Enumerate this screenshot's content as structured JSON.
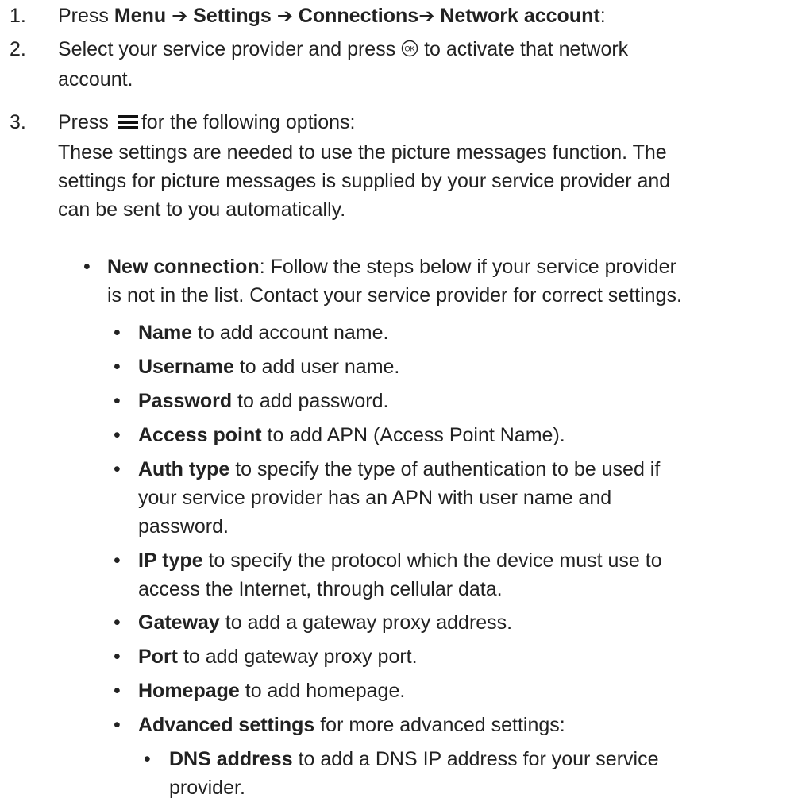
{
  "steps": [
    {
      "num": "1.",
      "press": "Press ",
      "menu": "Menu",
      "arrow": "➔",
      "settings": "Settings",
      "connections": "Connections",
      "network_account": "Network account",
      "tail": ":"
    },
    {
      "num": "2.",
      "line1_pre": "Select your service provider and press ",
      "line1_post": " to activate that network",
      "line2": "account."
    },
    {
      "num": "3.",
      "pre": "Press ",
      "post": "for the following options:",
      "para_line1": "These settings are needed to use the picture messages function. The",
      "para_line2": "settings for picture messages is supplied by your service provider and",
      "para_line3": "can be sent to you automatically."
    }
  ],
  "bullet_char": "•",
  "new_connection": {
    "label": "New connection",
    "line1": ": Follow the steps below if your service provider",
    "line2": "is not in the list. Contact your service provider for correct settings."
  },
  "options": [
    {
      "label": "Name",
      "lines": [
        " to add account name."
      ]
    },
    {
      "label": "Username",
      "lines": [
        " to add user name."
      ]
    },
    {
      "label": "Password",
      "lines": [
        " to add password."
      ]
    },
    {
      "label": "Access point",
      "lines": [
        " to add APN (Access Point Name)."
      ]
    },
    {
      "label": "Auth type",
      "lines": [
        " to specify the type of authentication to be used if",
        "your service provider has an APN with user name and",
        "password."
      ]
    },
    {
      "label": "IP type",
      "lines": [
        " to specify the protocol which the device must use to",
        "access the Internet, through cellular data."
      ]
    },
    {
      "label": "Gateway",
      "lines": [
        " to add a gateway proxy address."
      ]
    },
    {
      "label": "Port",
      "lines": [
        " to add gateway proxy port."
      ]
    },
    {
      "label": "Homepage",
      "lines": [
        " to add homepage."
      ]
    },
    {
      "label": "Advanced settings",
      "lines": [
        " for more advanced settings:"
      ]
    }
  ],
  "dns": {
    "label": "DNS address",
    "line1": " to add a DNS IP address for your service",
    "line2": "provider."
  },
  "icons": {
    "ok": "ok-button-icon",
    "menu": "hamburger-menu-icon"
  }
}
